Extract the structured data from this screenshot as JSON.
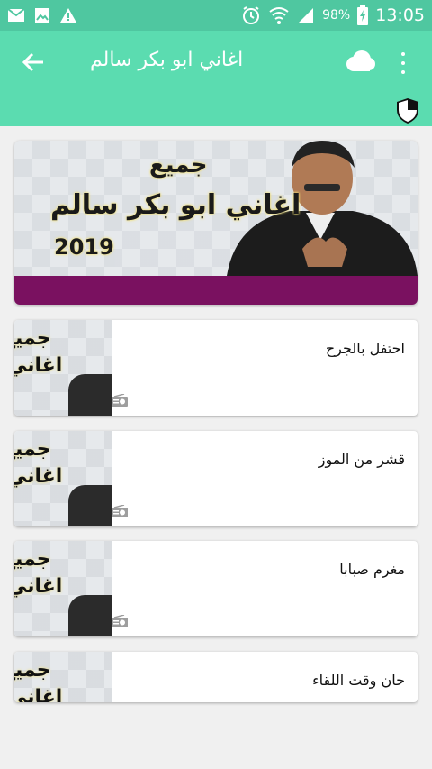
{
  "status_bar": {
    "battery": "98%",
    "time": "13:05"
  },
  "app_bar": {
    "title": "اغاني ابو بكر سالم"
  },
  "banner": {
    "line1": "جميع",
    "line2": "اغاني ابو بكر سالم",
    "line3": "2019",
    "strip_color": "#7a1160"
  },
  "thumb_text": {
    "line1": "جميع",
    "line2": "اغاني"
  },
  "songs": [
    {
      "title": "احتفل بالجرح"
    },
    {
      "title": "قشر من الموز"
    },
    {
      "title": "مغرم صبابا"
    },
    {
      "title": "حان وقت اللقاء"
    }
  ],
  "colors": {
    "status_bar": "#4fc7a0",
    "app_bar": "#5bdcb0"
  },
  "icons": [
    "mail-icon",
    "image-icon",
    "warning-icon",
    "alarm-icon",
    "wifi-icon",
    "signal-icon",
    "battery-icon",
    "back-arrow-icon",
    "cloud-icon",
    "more-vert-icon",
    "shield-icon",
    "radio-icon"
  ]
}
